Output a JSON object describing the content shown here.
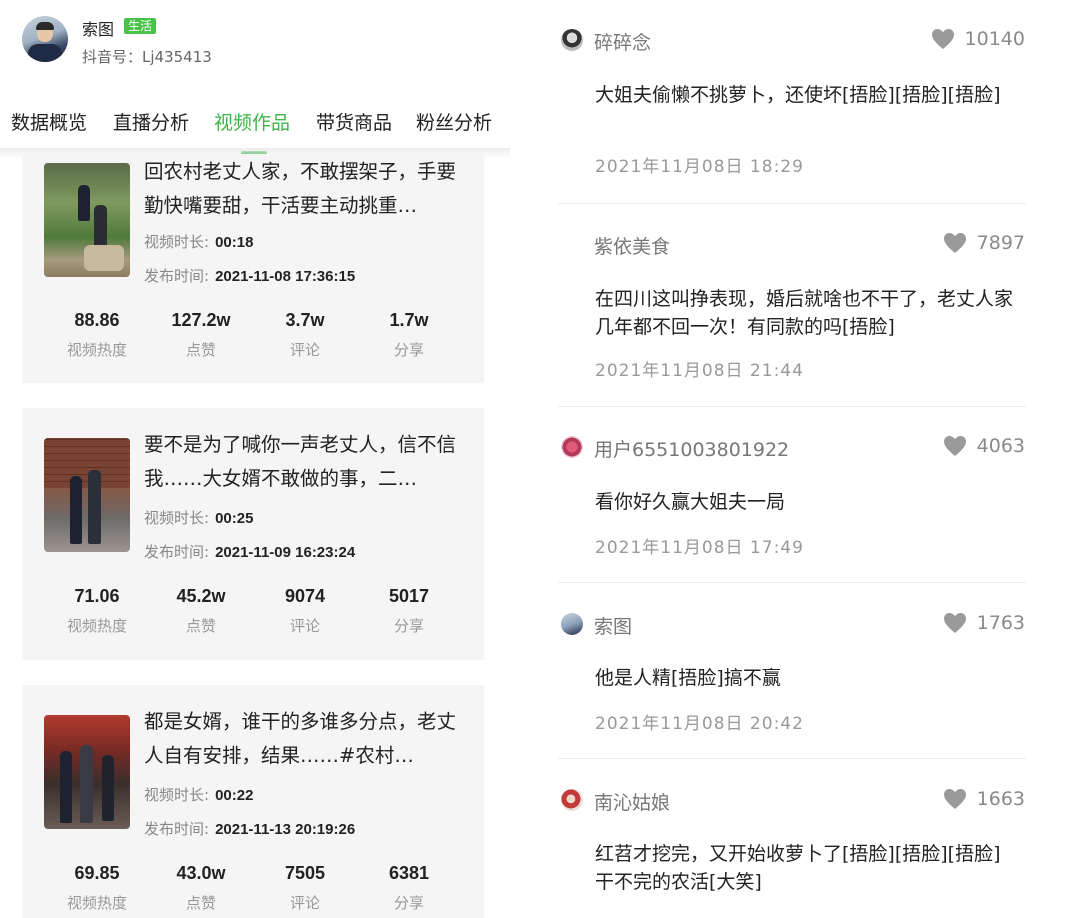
{
  "profile": {
    "name": "索图",
    "tag": "生活",
    "douyin_id": "抖音号：Lj435413"
  },
  "tabs": [
    "数据概览",
    "直播分析",
    "视频作品",
    "带货商品",
    "粉丝分析"
  ],
  "active_tab": "视频作品",
  "colors": {
    "accent": "#3db548",
    "tag_bg": "#49c24a",
    "card_bg": "#f5f5f5"
  },
  "videos": [
    {
      "title": "回农村老丈人家，不敢摆架子，手要勤快嘴要甜，干活要主动挑重…",
      "duration_label": "视频时长:",
      "duration": "00:18",
      "publish_label": "发布时间:",
      "publish_time": "2021-11-08 17:36:15",
      "stats": [
        {
          "value": "88.86",
          "label": "视频热度"
        },
        {
          "value": "127.2w",
          "label": "点赞"
        },
        {
          "value": "3.7w",
          "label": "评论"
        },
        {
          "value": "1.7w",
          "label": "分享"
        }
      ]
    },
    {
      "title": "要不是为了喊你一声老丈人，信不信我……大女婿不敢做的事，二…",
      "duration_label": "视频时长:",
      "duration": "00:25",
      "publish_label": "发布时间:",
      "publish_time": "2021-11-09 16:23:24",
      "stats": [
        {
          "value": "71.06",
          "label": "视频热度"
        },
        {
          "value": "45.2w",
          "label": "点赞"
        },
        {
          "value": "9074",
          "label": "评论"
        },
        {
          "value": "5017",
          "label": "分享"
        }
      ]
    },
    {
      "title": "都是女婿，谁干的多谁多分点，老丈人自有安排，结果……#农村…",
      "duration_label": "视频时长:",
      "duration": "00:22",
      "publish_label": "发布时间:",
      "publish_time": "2021-11-13 20:19:26",
      "stats": [
        {
          "value": "69.85",
          "label": "视频热度"
        },
        {
          "value": "43.0w",
          "label": "点赞"
        },
        {
          "value": "7505",
          "label": "评论"
        },
        {
          "value": "6381",
          "label": "分享"
        }
      ]
    }
  ],
  "comments": [
    {
      "user": "碎碎念",
      "likes": "10140",
      "text": "大姐夫偷懒不挑萝卜，还使坏[捂脸][捂脸][捂脸]",
      "time": "2021年11月08日  18:29",
      "avatar": "avatar-user"
    },
    {
      "user": "紫依美食",
      "likes": "7897",
      "text": "在四川这叫挣表现，婚后就啥也不干了，老丈人家几年都不回一次！有同款的吗[捂脸]",
      "time": "2021年11月08日  21:44",
      "avatar": "none"
    },
    {
      "user": "用户6551003801922",
      "likes": "4063",
      "text": "看你好久赢大姐夫一局",
      "time": "2021年11月08日  17:49",
      "avatar": "avatar-user"
    },
    {
      "user": "索图",
      "likes": "1763",
      "text": "他是人精[捂脸]搞不赢",
      "time": "2021年11月08日  20:42",
      "avatar": "avatar-user"
    },
    {
      "user": "南沁姑娘",
      "likes": "1663",
      "text": "红苕才挖完，又开始收萝卜了[捂脸][捂脸][捂脸]干不完的农活[大笑]",
      "time": "",
      "avatar": "avatar-user"
    }
  ]
}
